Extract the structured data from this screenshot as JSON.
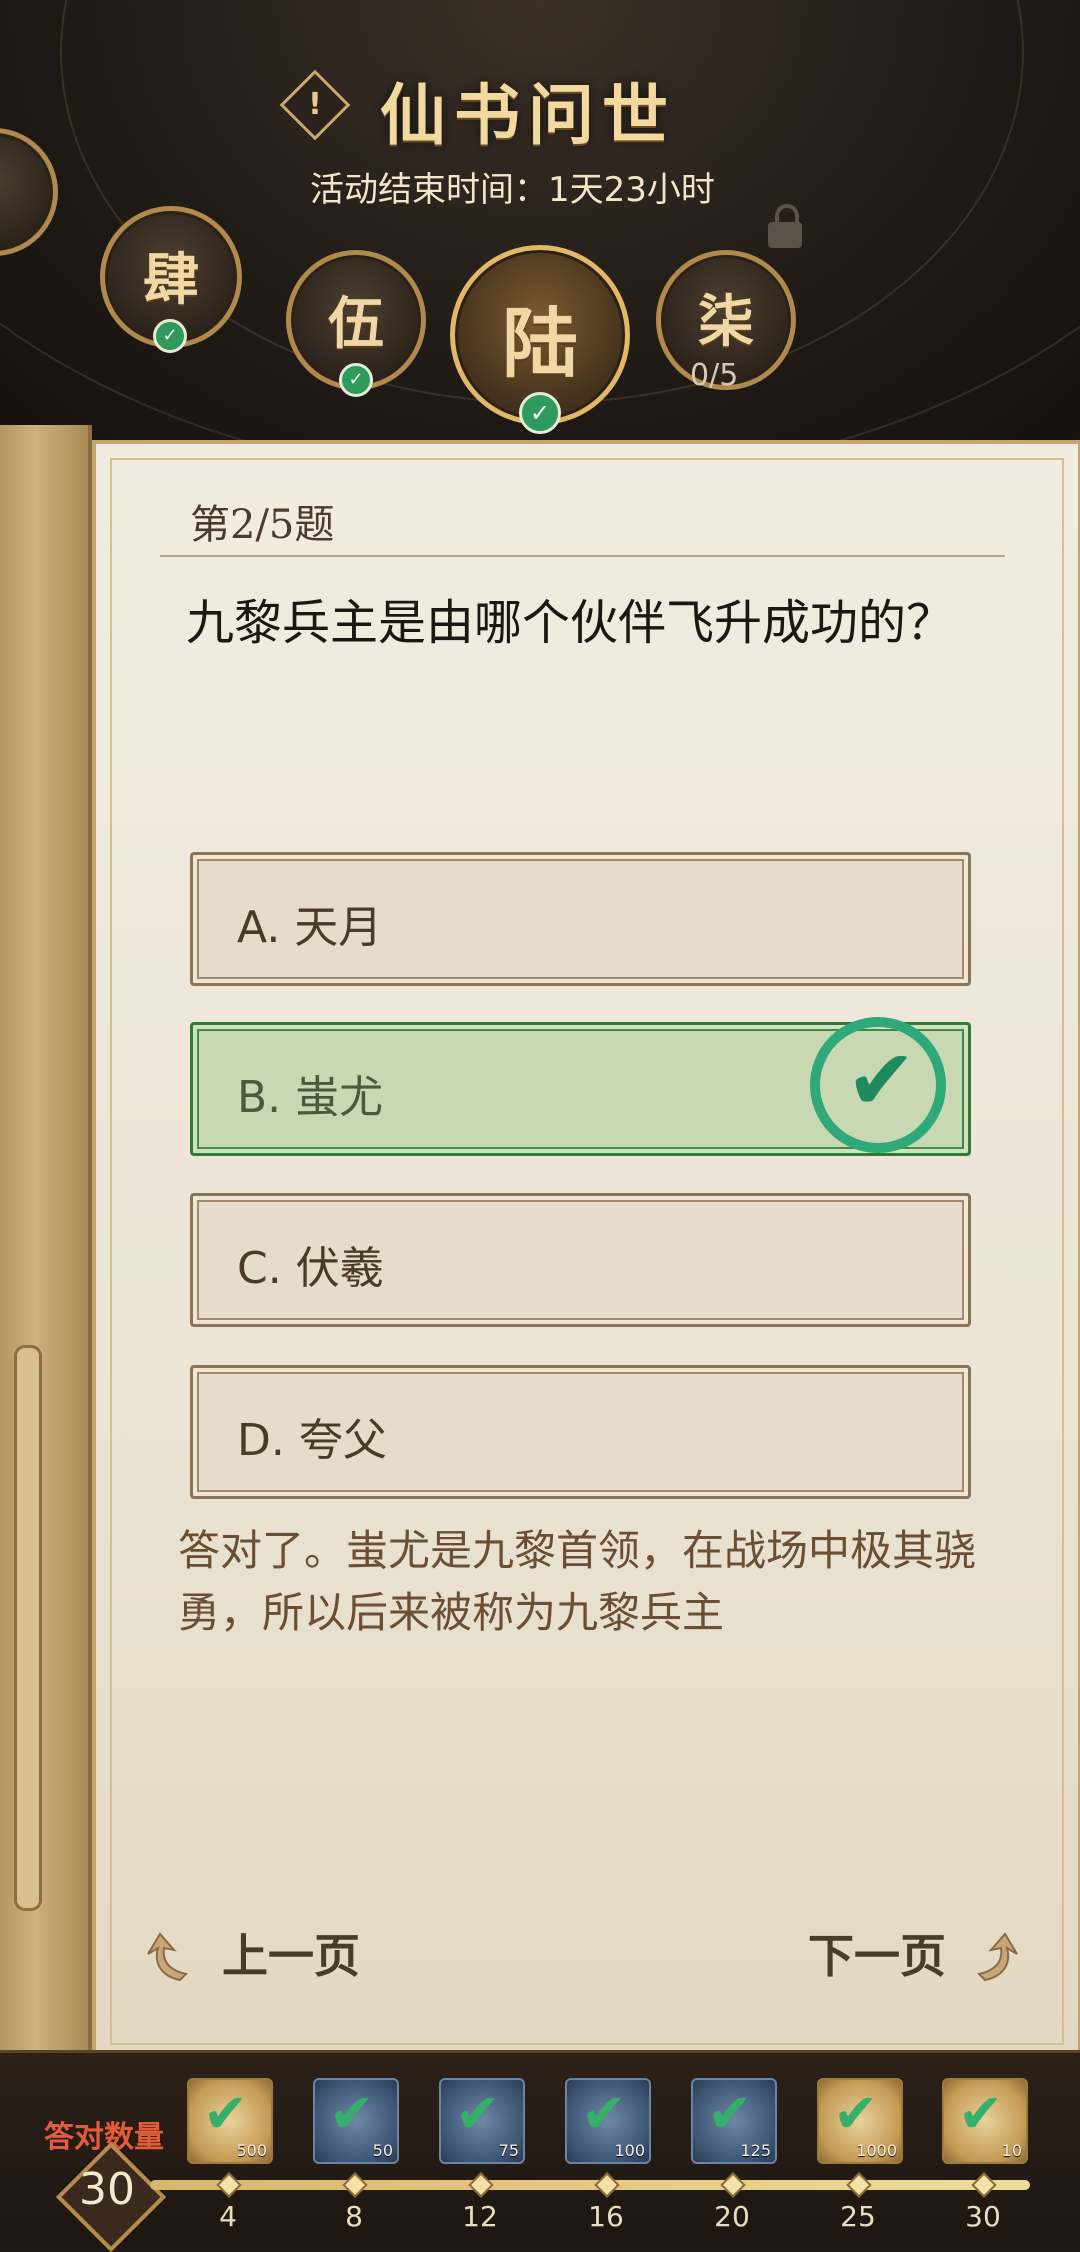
{
  "header": {
    "title": "仙书问世",
    "info_icon": "!",
    "subtitle": "活动结束时间：1天23小时"
  },
  "chapters": [
    {
      "glyph": "肆",
      "status": "done",
      "icon": "book-icon"
    },
    {
      "glyph": "伍",
      "status": "done",
      "icon": "book-icon"
    },
    {
      "glyph": "陆",
      "status": "current",
      "icon": "book-icon"
    },
    {
      "glyph": "柒",
      "status": "locked",
      "progress": "0/5",
      "icon": "lock-icon"
    }
  ],
  "quiz": {
    "number": "第2/5题",
    "question": "九黎兵主是由哪个伙伴飞升成功的？",
    "options": [
      {
        "label": "A. 天月",
        "state": "normal"
      },
      {
        "label": "B. 蚩尤",
        "state": "correct"
      },
      {
        "label": "C. 伏羲",
        "state": "normal"
      },
      {
        "label": "D. 夸父",
        "state": "normal"
      }
    ],
    "explanation": "答对了。蚩尤是九黎首领，在战场中极其骁勇，所以后来被称为九黎兵主"
  },
  "nav": {
    "prev": "上一页",
    "next": "下一页"
  },
  "rewards": {
    "label": "答对数量",
    "count": "30",
    "progress_fraction": 1.0,
    "items": [
      {
        "amount": "500",
        "milestone": "4",
        "kind": "gold"
      },
      {
        "amount": "50",
        "milestone": "8",
        "kind": "blue"
      },
      {
        "amount": "75",
        "milestone": "12",
        "kind": "blue"
      },
      {
        "amount": "100",
        "milestone": "16",
        "kind": "blue"
      },
      {
        "amount": "125",
        "milestone": "20",
        "kind": "blue"
      },
      {
        "amount": "1000",
        "milestone": "25",
        "kind": "gold"
      },
      {
        "amount": "10",
        "milestone": "30",
        "kind": "gold"
      }
    ]
  },
  "colors": {
    "correct_green": "#2f7d34",
    "accent_gold": "#c9a86a",
    "count_red": "#e45b3a"
  }
}
